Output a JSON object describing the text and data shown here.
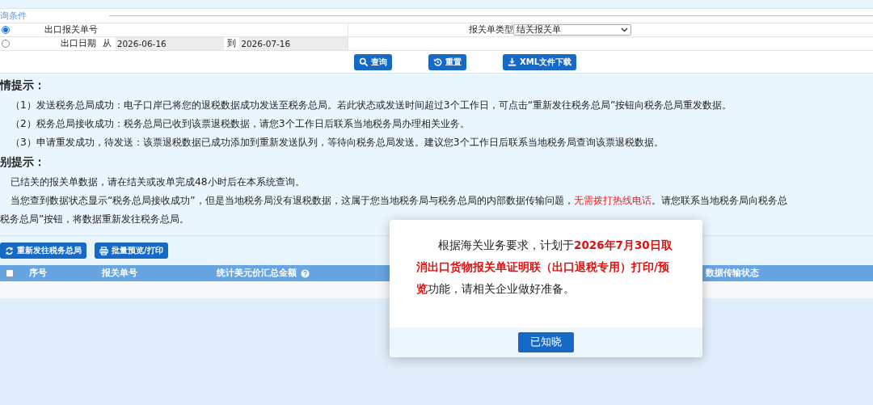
{
  "query": {
    "legend": "询条件",
    "mode_options": [
      {
        "label": "出口报关单号",
        "selected": true
      },
      {
        "label": "出口日期",
        "selected": false
      }
    ],
    "date_from_label": "从",
    "date_from": "2026-06-16",
    "date_to_label": "到",
    "date_to": "2026-07-16",
    "type_label": "报关单类型",
    "type_value": "结关报关单",
    "buttons": [
      {
        "label": "查询"
      },
      {
        "label": "重置"
      },
      {
        "label": "XML文件下载"
      }
    ]
  },
  "hints": [
    {
      "title": "情提示：",
      "lines": [
        [
          {
            "text": "（1）发送税务总局成功：电子口岸已将您的退税数据成功发送至税务总局。若此状态或发送时间超过3个工作日，可点击“重新发往税务总局”按钮向税务总局重发数据。",
            "kind": "normal"
          }
        ],
        [
          {
            "text": "（2）税务总局接收成功：税务总局已收到该票退税数据，请您3个工作日后联系当地税务局办理相关业务。",
            "kind": "normal"
          }
        ],
        [
          {
            "text": "（3）申请重发成功，待发送：该票退税数据已成功添加到重新发送队列，等待向税务总局发送。建议您3个工作日后联系当地税务局查询该票退税数据。",
            "kind": "normal"
          }
        ]
      ]
    },
    {
      "title": "别提示：",
      "lines": [
        [
          {
            "text": "已结关的报关单数据，请在结关或改单完成48小时后在本系统查询。",
            "kind": "normal"
          }
        ],
        [
          {
            "text": "当您查到数据状态显示“税务总局接收成功”，但是当地税务局没有退税数据，这属于您当地税务局与税务总局的内部数据传输问题，",
            "kind": "normal"
          },
          {
            "text": "无需拨打热线电话",
            "kind": "alert"
          },
          {
            "text": "。请您联系当地税务局向税务总",
            "kind": "normal"
          }
        ],
        [
          {
            "text": "税务总局”按钮，将数据重新发往税务总局。",
            "kind": "normal"
          }
        ]
      ]
    }
  ],
  "actions": [
    {
      "label": "重新发往税务总局"
    },
    {
      "label": "批量预览/打印"
    }
  ],
  "table": {
    "select_all_checked": false,
    "columns": [
      {
        "label": "序号",
        "help": false
      },
      {
        "label": "报关单号",
        "help": false
      },
      {
        "label": "统计美元价汇总金额",
        "help": true
      },
      {
        "label": "数据传输状态",
        "help": false
      }
    ]
  },
  "dialog": {
    "message": [
      {
        "text": "根据海关业务要求，计划于",
        "kind": "normal"
      },
      {
        "text": "2026年7月30日取消出口货物报关单证明联（出口退税专用）打印/预览",
        "kind": "emphasis"
      },
      {
        "text": "功能，请相关企业做好准备。",
        "kind": "normal"
      }
    ],
    "button": "已知晓"
  }
}
